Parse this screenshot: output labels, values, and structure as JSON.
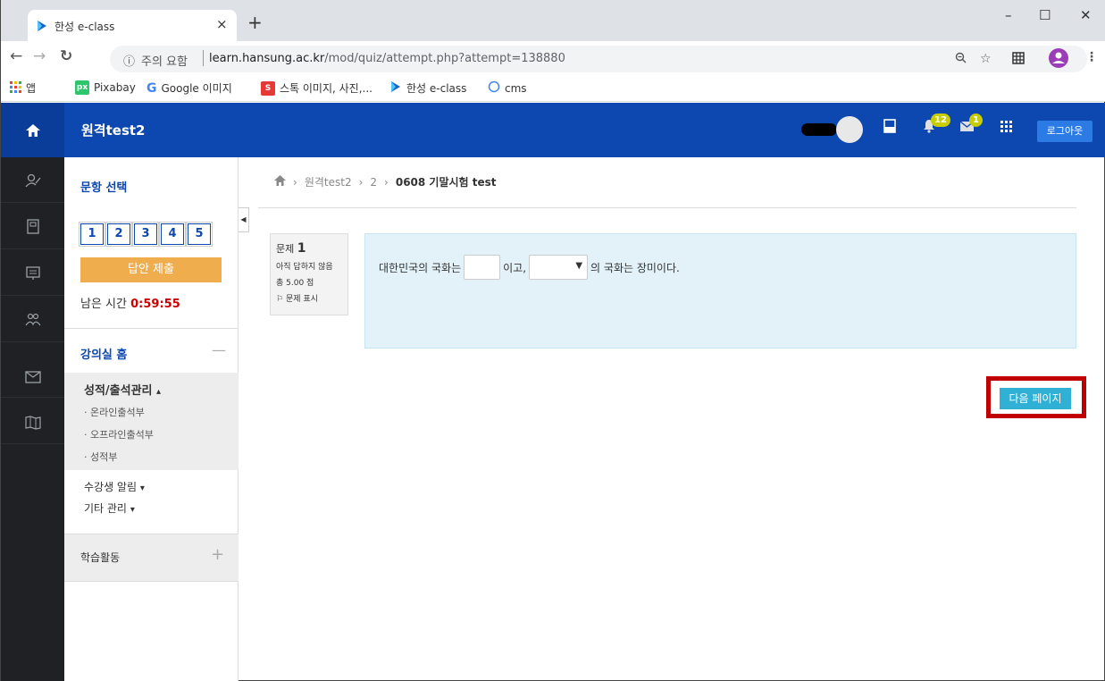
{
  "browser": {
    "tab_title": "한성 e-class",
    "tab_close": "×",
    "new_tab": "+",
    "win_min": "–",
    "win_max": "☐",
    "win_close": "✕",
    "security_icon": "ⓘ",
    "security_text": "주의 요함",
    "url_host": "learn.hansung.ac.kr",
    "url_path": "/mod/quiz/attempt.php?attempt=138880",
    "bookmarks": {
      "apps": "앱",
      "pixabay": "Pixabay",
      "google_images": "Google 이미지",
      "stock": "스톡 이미지, 사진,...",
      "eclass": "한성 e-class",
      "cms": "cms"
    }
  },
  "header": {
    "site_title": "원격test2",
    "notifications_count": "12",
    "messages_count": "1",
    "logout_label": "로그아웃"
  },
  "sidebar": {
    "quiz_nav_title": "문항 선택",
    "question_numbers": [
      "1",
      "2",
      "3",
      "4",
      "5"
    ],
    "submit_label": "답안 제출",
    "time_label": "남은 시간",
    "time_value": "0:59:55",
    "course_home": "강의실 홈",
    "grade_menu": "성적/출석관리",
    "grade_menu_chevron": "▴",
    "grade_items": [
      "온라인출석부",
      "오프라인출석부",
      "성적부"
    ],
    "notify_menu": "수강생 알림",
    "other_menu": "기타 관리",
    "dropdown_chevron": "▾",
    "activities": "학습활동"
  },
  "breadcrumb": {
    "course": "원격test2",
    "section": "2",
    "current": "0608 기말시험 test"
  },
  "question": {
    "label": "문제",
    "number": "1",
    "status": "아직 답하지 않음",
    "marks": "총 5.00 점",
    "flag": "문제 표시",
    "text_part1": "대한민국의 국화는",
    "text_part2": "이고,",
    "text_part3": "의 국화는 장미이다."
  },
  "actions": {
    "next_page": "다음 페이지"
  }
}
